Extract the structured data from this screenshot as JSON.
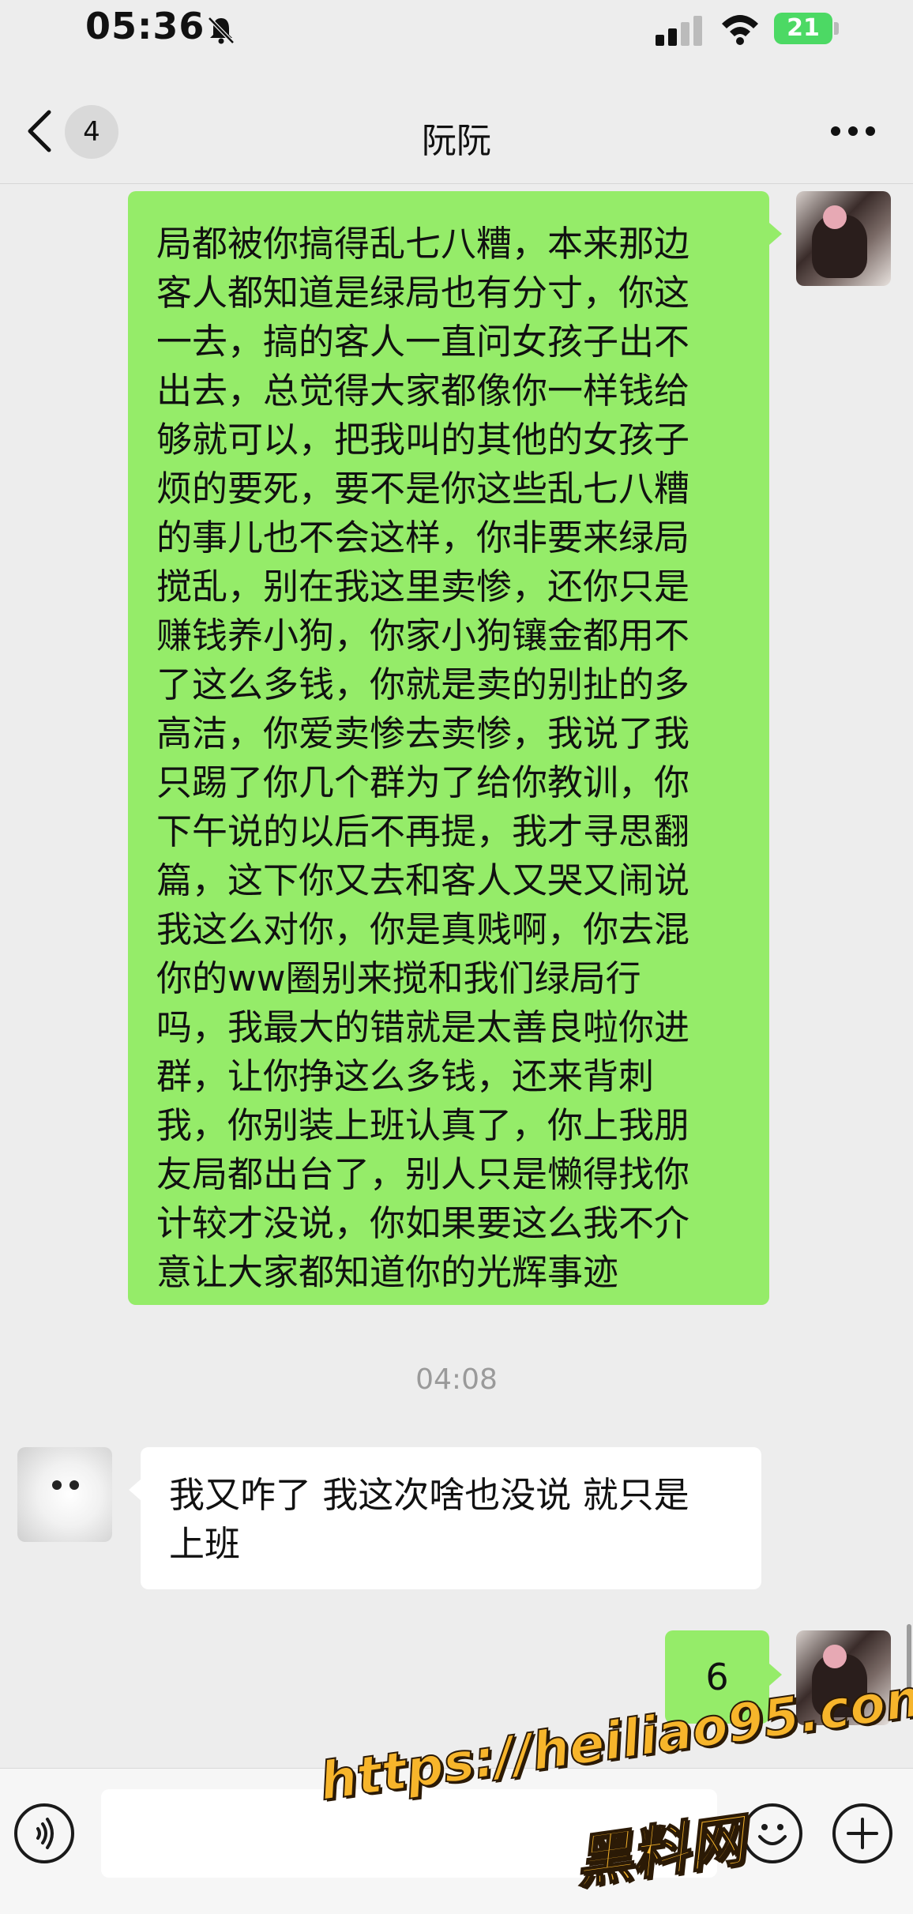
{
  "status_bar": {
    "time": "05:36",
    "battery": "21"
  },
  "header": {
    "back_count": "4",
    "title": "阮阮"
  },
  "messages": [
    {
      "side": "right",
      "text": "局都被你搞得乱七八糟，本来那边\n客人都知道是绿局也有分寸，你这\n一去，搞的客人一直问女孩子出不\n出去，总觉得大家都像你一样钱给\n够就可以，把我叫的其他的女孩子\n烦的要死，要不是你这些乱七八糟\n的事儿也不会这样，你非要来绿局\n搅乱，别在我这里卖惨，还你只是\n赚钱养小狗，你家小狗镶金都用不\n了这么多钱，你就是卖的别扯的多\n高洁，你爱卖惨去卖惨，我说了我\n只踢了你几个群为了给你教训，你\n下午说的以后不再提，我才寻思翻\n篇，这下你又去和客人又哭又闹说\n我这么对你，你是真贱啊，你去混\n你的ww圈别来搅和我们绿局行\n吗，我最大的错就是太善良啦你进\n群，让你挣这么多钱，还来背刺\n我，你别装上班认真了，你上我朋\n友局都出台了，别人只是懒得找你\n计较才没说，你如果要这么我不介\n意让大家都知道你的光辉事迹"
    },
    {
      "side": "center",
      "text": "04:08"
    },
    {
      "side": "left",
      "text": "我又咋了 我这次啥也没说 就只是\n上班"
    },
    {
      "side": "right",
      "text": "6"
    }
  ],
  "watermark": {
    "url": "https://heiliao95.com",
    "name": "黑料网"
  },
  "colors": {
    "outgoing_bubble": "#95ec69",
    "incoming_bubble": "#ffffff",
    "background": "#ededed",
    "battery": "#4cd964"
  },
  "icons": [
    "bell-slash-icon",
    "signal-icon",
    "wifi-icon",
    "back-chevron-icon",
    "more-dots-icon",
    "voice-icon",
    "emoji-icon",
    "plus-icon"
  ]
}
